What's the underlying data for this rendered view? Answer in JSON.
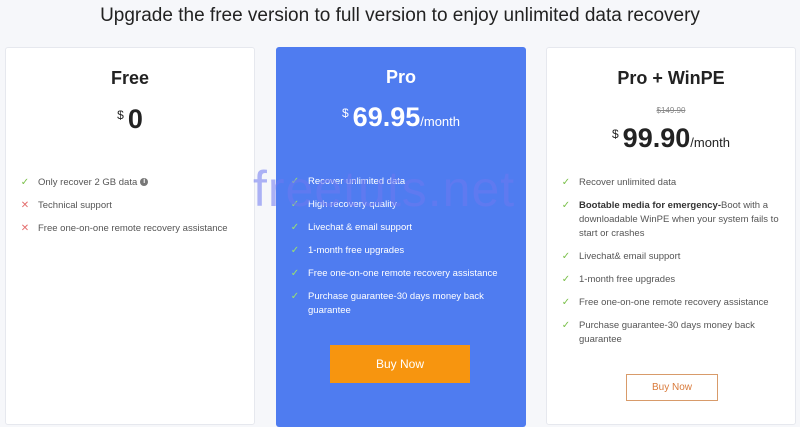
{
  "headline": "Upgrade the free version to full version to enjoy unlimited data recovery",
  "watermark": "freetuts.net",
  "plans": {
    "free": {
      "title": "Free",
      "currency": "$",
      "amount": "0",
      "features": [
        {
          "icon": "check-icon",
          "text": "Only recover 2 GB data",
          "info_icon": "info-icon",
          "info_glyph": "i"
        },
        {
          "icon": "cross-icon",
          "text": "Technical support"
        },
        {
          "icon": "cross-icon",
          "text": "Free one-on-one remote recovery assistance"
        }
      ]
    },
    "pro": {
      "title": "Pro",
      "currency": "$",
      "amount": "69.95",
      "period": "/month",
      "accent_color": "#4f7cf0",
      "features": [
        {
          "icon": "check-icon",
          "text": "Recover unlimited data"
        },
        {
          "icon": "check-icon",
          "text": "High recovery quality"
        },
        {
          "icon": "check-icon",
          "text": "Livechat & email support"
        },
        {
          "icon": "check-icon",
          "text": "1-month free upgrades"
        },
        {
          "icon": "check-icon",
          "text": "Free one-on-one remote recovery assistance"
        },
        {
          "icon": "check-icon",
          "text": "Purchase guarantee-30 days money back guarantee"
        }
      ],
      "button_label": "Buy Now",
      "button_color": "#f7950f"
    },
    "winpe": {
      "title": "Pro + WinPE",
      "old_price": "$149.90",
      "currency": "$",
      "amount": "99.90",
      "period": "/month",
      "features": [
        {
          "icon": "check-icon",
          "text": "Recover unlimited data"
        },
        {
          "icon": "check-icon",
          "bold": "Bootable media for emergency-",
          "text": "Boot with a downloadable WinPE when your system fails to start or crashes"
        },
        {
          "icon": "check-icon",
          "text": "Livechat& email support"
        },
        {
          "icon": "check-icon",
          "text": "1-month free upgrades"
        },
        {
          "icon": "check-icon",
          "text": "Free one-on-one remote recovery assistance"
        },
        {
          "icon": "check-icon",
          "text": "Purchase guarantee-30 days money back guarantee"
        }
      ],
      "button_label": "Buy Now"
    }
  },
  "glyphs": {
    "check": "✓",
    "cross": "✕"
  }
}
